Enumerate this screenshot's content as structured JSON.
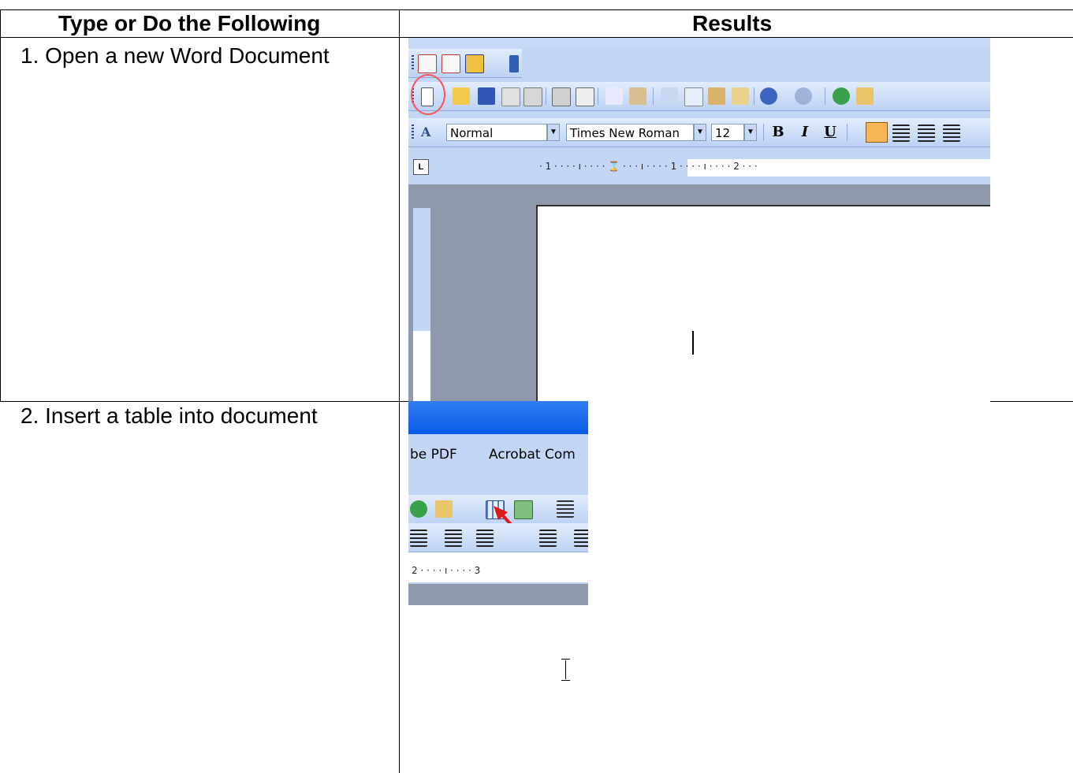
{
  "table": {
    "header": {
      "col1": "Type or Do the Following",
      "col2": "Results"
    },
    "rows": [
      {
        "step": "1. Open a new Word Document"
      },
      {
        "step": "2. Insert a table into document"
      }
    ]
  },
  "screenshot1": {
    "style_box": "Normal",
    "font_box": "Times New Roman",
    "size_box": "12",
    "bold": "B",
    "italic": "I",
    "underline": "U",
    "ruler": "· 1 · · · · ı · · · · ⌛ · · · ı · · · · 1 · · · · ı · · · · 2 · · ·",
    "colors": {
      "toolbar": "#c4d6f6",
      "page_bg": "#8f99ab",
      "highlight": "#ff5555"
    }
  },
  "screenshot2": {
    "menu_item_1": "be PDF",
    "menu_item_2": "Acrobat Com",
    "ruler": "2 · · · · ı · · · · 3",
    "colors": {
      "titlebar": "#0a5ce8",
      "arrow": "#e01a1a"
    }
  }
}
